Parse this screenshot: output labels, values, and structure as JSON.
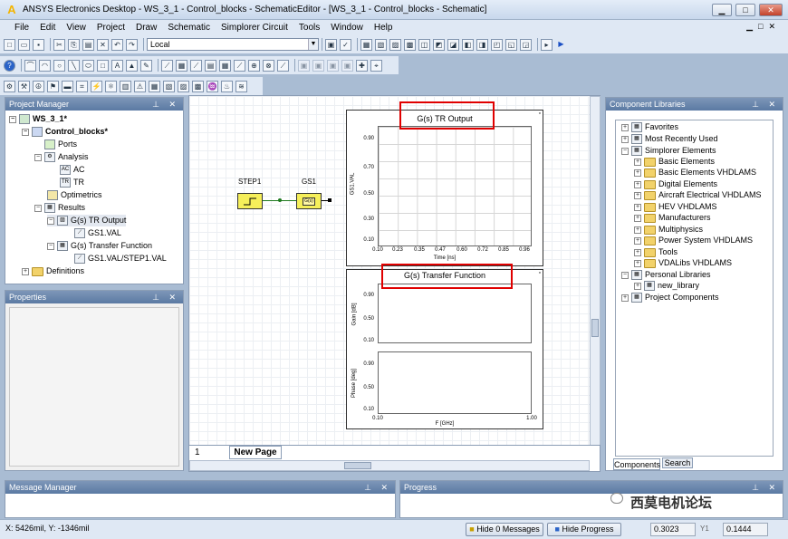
{
  "window": {
    "title": "ANSYS Electronics Desktop - WS_3_1 - Control_blocks - SchematicEditor - [WS_3_1 - Control_blocks - Schematic]",
    "logo": "A"
  },
  "menu": [
    "File",
    "Edit",
    "View",
    "Project",
    "Draw",
    "Schematic",
    "Simplorer Circuit",
    "Tools",
    "Window",
    "Help"
  ],
  "toolbar": {
    "machine_combo": "Local"
  },
  "project_manager": {
    "title": "Project Manager",
    "items": [
      {
        "label": "WS_3_1*",
        "icon": "project-icon"
      },
      {
        "label": "Control_blocks*",
        "icon": "design-icon"
      },
      {
        "label": "Ports",
        "icon": "ports-icon"
      },
      {
        "label": "Analysis",
        "icon": "analysis-icon"
      },
      {
        "label": "AC",
        "icon": "ac-icon"
      },
      {
        "label": "TR",
        "icon": "tr-icon"
      },
      {
        "label": "Optimetrics",
        "icon": "optimetrics-icon"
      },
      {
        "label": "Results",
        "icon": "results-icon"
      },
      {
        "label": "G(s) TR Output",
        "icon": "report-icon"
      },
      {
        "label": "GS1.VAL",
        "icon": "trace-icon"
      },
      {
        "label": "G(s) Transfer Function",
        "icon": "report-icon"
      },
      {
        "label": "GS1.VAL/STEP1.VAL",
        "icon": "trace-icon"
      },
      {
        "label": "Definitions",
        "icon": "folder-icon"
      }
    ]
  },
  "properties": {
    "title": "Properties"
  },
  "schematic": {
    "step_label": "STEP1",
    "gs_label": "GS1",
    "gs_block_text": "G(s)",
    "page_number": "1",
    "page_tab": "New Page"
  },
  "plot1": {
    "title": "G(s) TR Output",
    "ylabel": "GS1.VAL",
    "xlabel": "Time [ns]",
    "yticks": [
      "0.90",
      "0.70",
      "0.50",
      "0.30",
      "0.10"
    ],
    "xticks": [
      "0.10",
      "0.23",
      "0.35",
      "0.47",
      "0.60",
      "0.72",
      "0.85",
      "0.96"
    ]
  },
  "plot2": {
    "title": "G(s) Transfer Function",
    "ylabel_gain": "Gain [dB]",
    "ylabel_phase": "Phase [deg]",
    "xlabel": "F [GHz]",
    "gain_yticks": [
      "0.90",
      "0.50",
      "0.10"
    ],
    "phase_yticks": [
      "0.90",
      "0.50",
      "0.10"
    ],
    "xticks": [
      "0.10",
      "1.00"
    ]
  },
  "component_libraries": {
    "title": "Component Libraries",
    "items": [
      {
        "label": "Favorites",
        "level": 0
      },
      {
        "label": "Most Recently Used",
        "level": 0
      },
      {
        "label": "Simplorer Elements",
        "level": 0
      },
      {
        "label": "Basic Elements",
        "level": 1
      },
      {
        "label": "Basic Elements VHDLAMS",
        "level": 1
      },
      {
        "label": "Digital Elements",
        "level": 1
      },
      {
        "label": "Aircraft Electrical VHDLAMS",
        "level": 1
      },
      {
        "label": "HEV VHDLAMS",
        "level": 1
      },
      {
        "label": "Manufacturers",
        "level": 1
      },
      {
        "label": "Multiphysics",
        "level": 1
      },
      {
        "label": "Power System VHDLAMS",
        "level": 1
      },
      {
        "label": "Tools",
        "level": 1
      },
      {
        "label": "VDALibs VHDLAMS",
        "level": 1
      },
      {
        "label": "Personal Libraries",
        "level": 0
      },
      {
        "label": "new_library",
        "level": 1
      },
      {
        "label": "Project Components",
        "level": 0
      }
    ],
    "tabs": [
      "Components",
      "Search"
    ]
  },
  "message_manager": {
    "title": "Message Manager"
  },
  "progress": {
    "title": "Progress"
  },
  "watermark": "西莫电机论坛",
  "status": {
    "coords": "X: 5426mil, Y: -1346mil",
    "hide_messages": "Hide 0 Messages",
    "hide_progress": "Hide Progress",
    "x_value": "0.3023",
    "y_label": "Y1",
    "y_value": "0.1444"
  },
  "colors": {
    "highlight_box": "#e00000",
    "panel_header": "#5b7aa3"
  }
}
